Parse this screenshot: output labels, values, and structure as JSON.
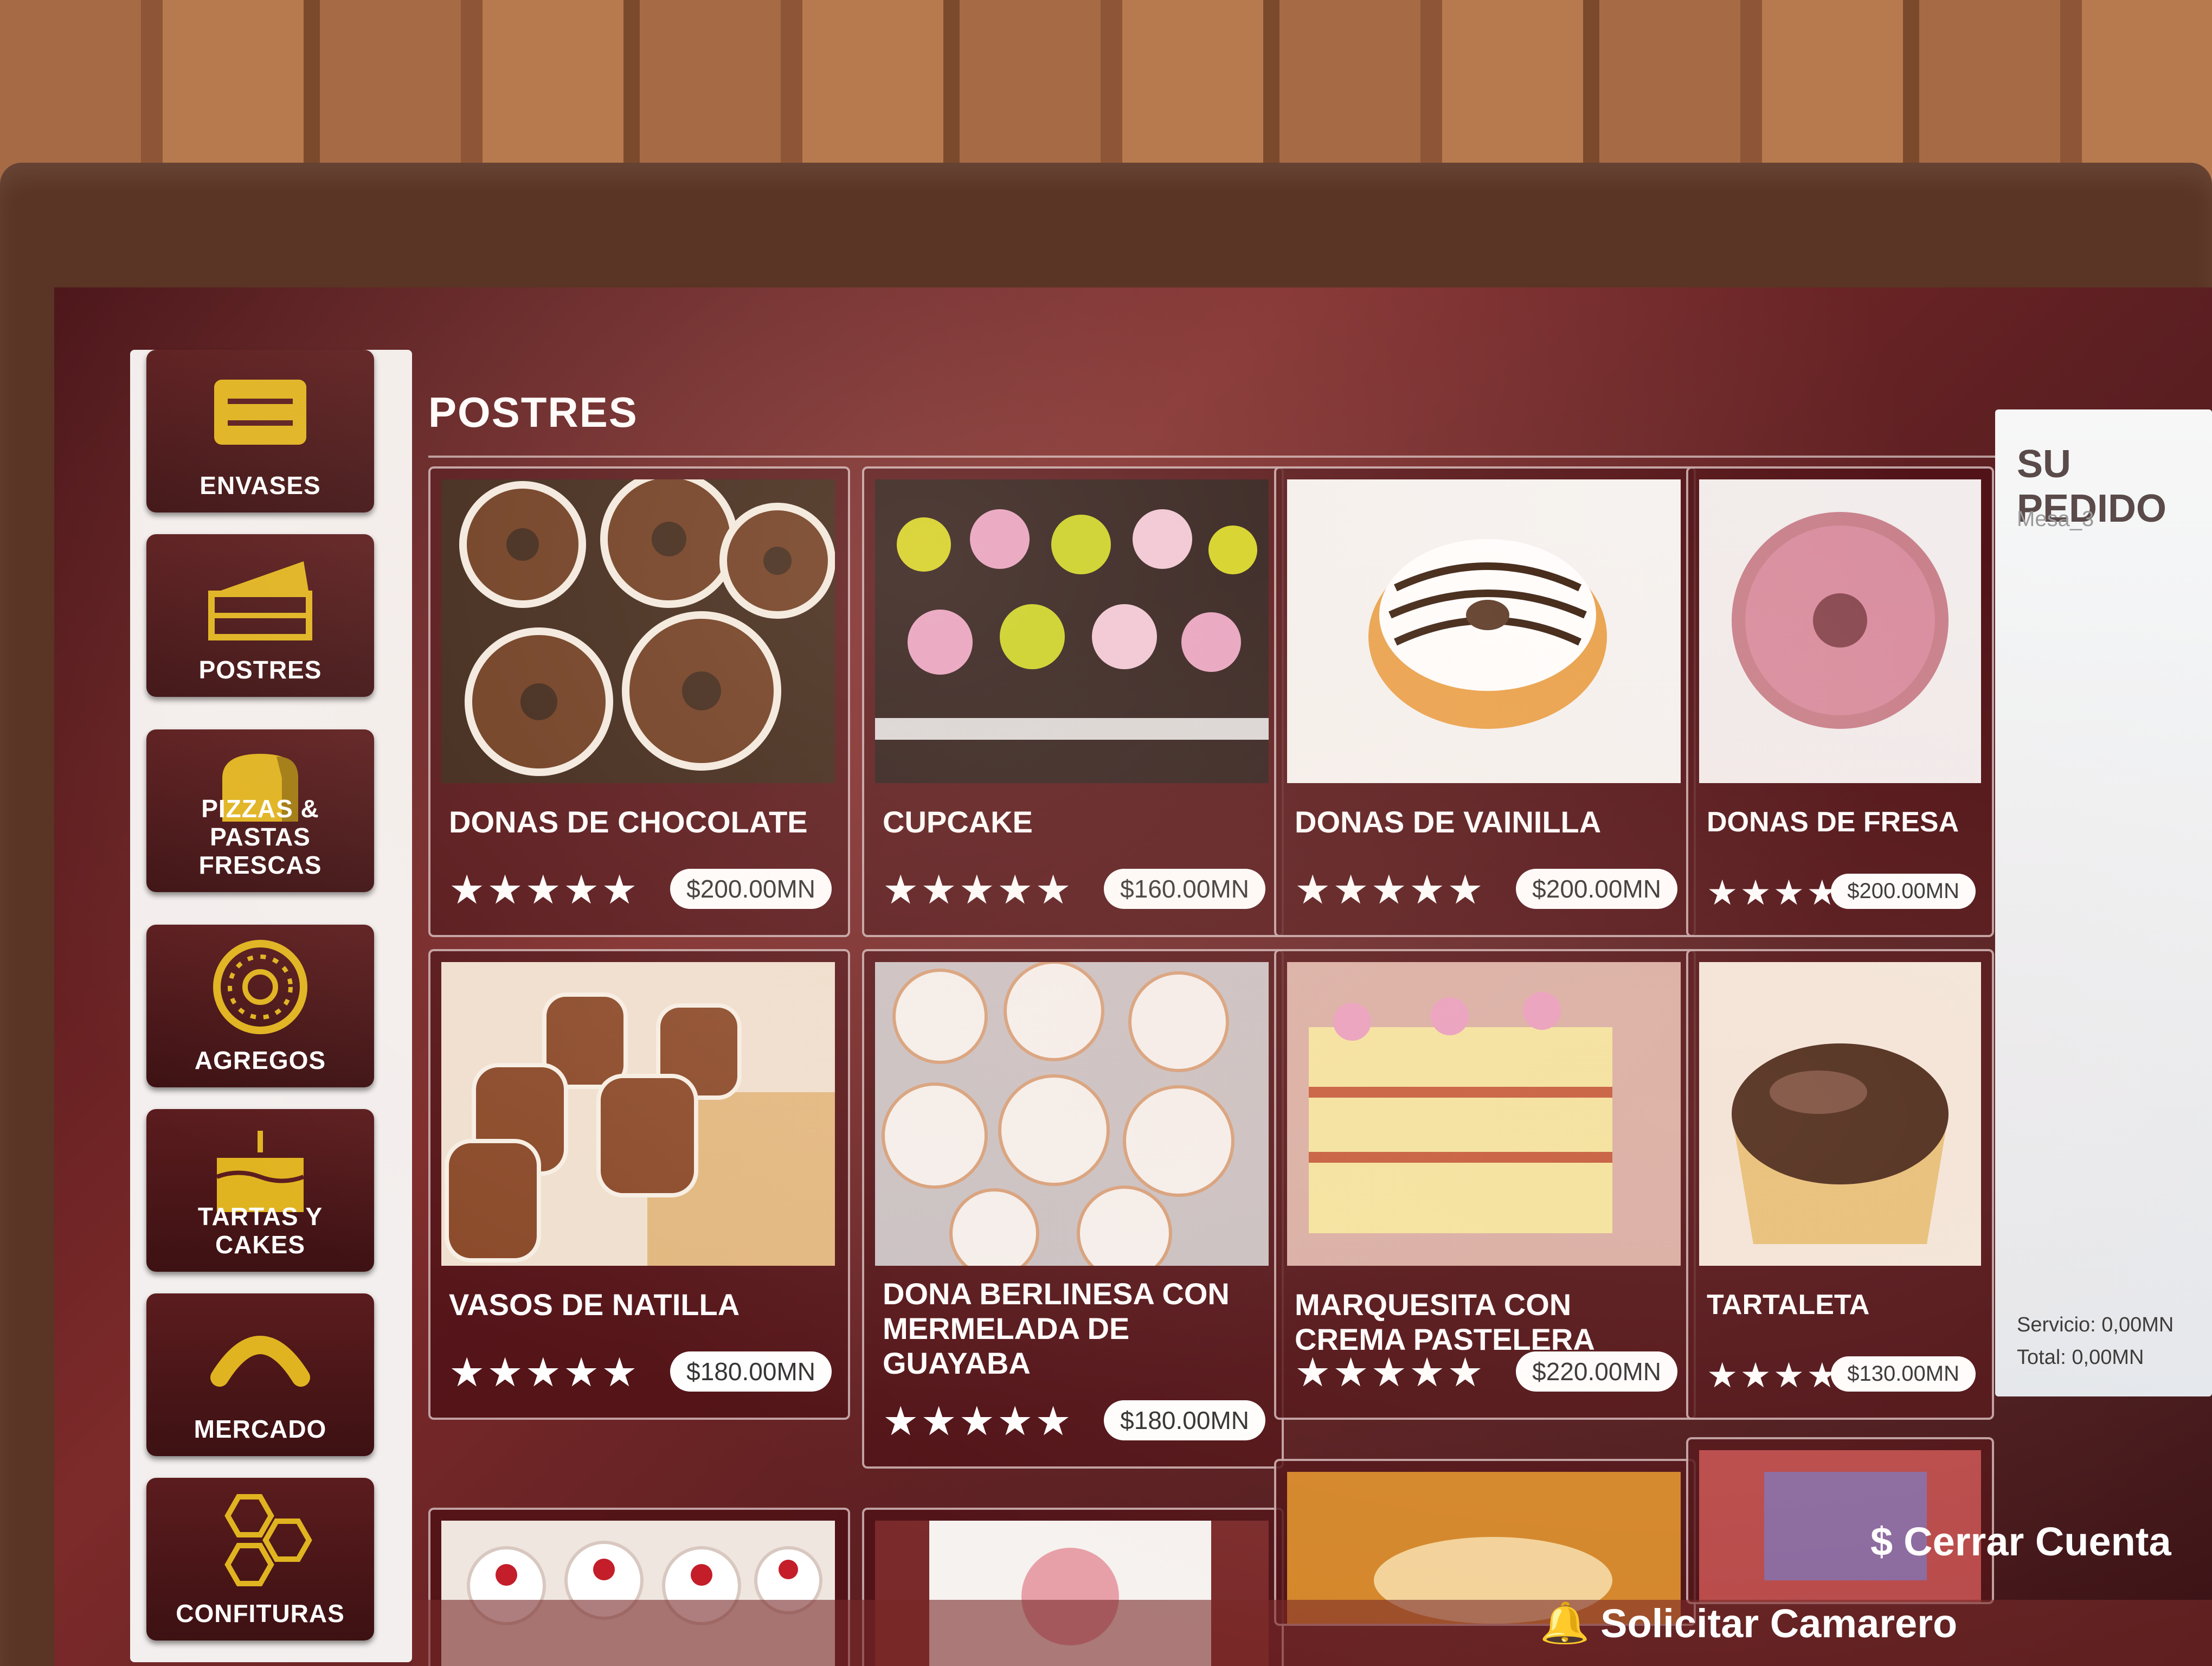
{
  "colors": {
    "screen_bg": "#5d1f22",
    "card_bg": "#501216",
    "icon_gold": "#e0b420",
    "sidebar_bg": "#f3efee",
    "price_bg": "#ffffff"
  },
  "sidebar": {
    "items": [
      {
        "label": "ENVASES",
        "icon": "toaster-icon"
      },
      {
        "label": "POSTRES",
        "icon": "cake-slice-icon"
      },
      {
        "label": "PIZZAS & PASTAS FRESCAS",
        "icon": "bread-icon"
      },
      {
        "label": "AGREGOS",
        "icon": "donut-icon"
      },
      {
        "label": "TARTAS Y CAKES",
        "icon": "birthday-cake-icon"
      },
      {
        "label": "MERCADO",
        "icon": "sausage-icon"
      },
      {
        "label": "CONFITURAS",
        "icon": "honeycomb-icon"
      }
    ]
  },
  "main": {
    "title": "POSTRES",
    "products": [
      {
        "name": "DONAS DE CHOCOLATE",
        "price": "$200.00MN",
        "stars": "★★★★★"
      },
      {
        "name": "CUPCAKE",
        "price": "$160.00MN",
        "stars": "★★★★★"
      },
      {
        "name": "DONAS DE VAINILLA",
        "price": "$200.00MN",
        "stars": "★★★★★"
      },
      {
        "name": "DONAS DE FRESA",
        "price": "$200.00MN",
        "stars": "★★★★★"
      },
      {
        "name": "VASOS DE NATILLA",
        "price": "$180.00MN",
        "stars": "★★★★★"
      },
      {
        "name": "DONA BERLINESA CON MERMELADA DE GUAYABA",
        "price": "$180.00MN",
        "stars": "★★★★★"
      },
      {
        "name": "MARQUESITA CON CREMA PASTELERA",
        "price": "$220.00MN",
        "stars": "★★★★★"
      },
      {
        "name": "TARTALETA",
        "price": "$130.00MN",
        "stars": "★★★★★"
      }
    ]
  },
  "order": {
    "title": "SU PEDIDO",
    "table": "Mesa_3",
    "service": "Servicio: 0,00MN",
    "total": "Total: 0,00MN"
  },
  "footer": {
    "call_waiter": "Solicitar Camarero",
    "close_bill": "Cerrar Cuenta"
  }
}
